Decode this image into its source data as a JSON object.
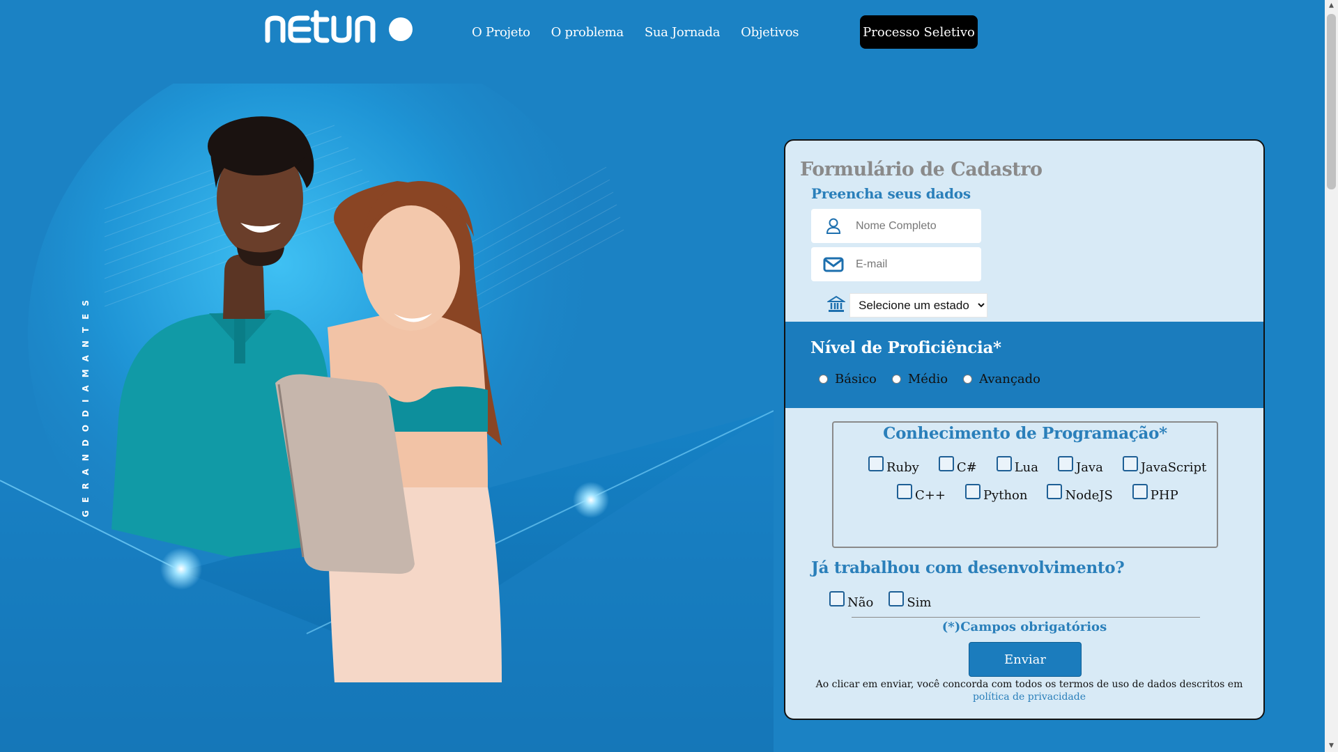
{
  "brand": {
    "logo_text": "netuno"
  },
  "nav": {
    "items": [
      "O Projeto",
      "O problema",
      "Sua Jornada",
      "Objetivos"
    ],
    "cta": "Processo Seletivo"
  },
  "hero": {
    "vertical_tagline": "GERANDODIAMANTES"
  },
  "form": {
    "title": "Formulário de Cadastro",
    "subtitle": "Preencha seus dados",
    "name_placeholder": "Nome Completo",
    "email_placeholder": "E-mail",
    "state_selected": "Selecione um estado",
    "proficiency": {
      "title": "Nível de Proficiência*",
      "options": [
        "Básico",
        "Médio",
        "Avançado"
      ]
    },
    "programming": {
      "title": "Conhecimento de Programação*",
      "row1": [
        "Ruby",
        "C#",
        "Lua",
        "Java",
        "JavaScript"
      ],
      "row2": [
        "C++",
        "Python",
        "NodeJS",
        "PHP"
      ]
    },
    "experience": {
      "title": "Já trabalhou com desenvolvimento?",
      "options": [
        "Não",
        "Sim"
      ]
    },
    "required_note": "(*)Campos obrigatórios",
    "submit": "Enviar",
    "terms_text": "Ao clicar em enviar, você concorda com todos os termos de uso de dados descritos em ",
    "terms_link": "política de privacidade"
  },
  "colors": {
    "background": "#1b82c4",
    "form_bg": "#d8eaf6",
    "accent": "#2a7fba",
    "band": "#1b7cbd",
    "cta_bg": "#000000"
  }
}
